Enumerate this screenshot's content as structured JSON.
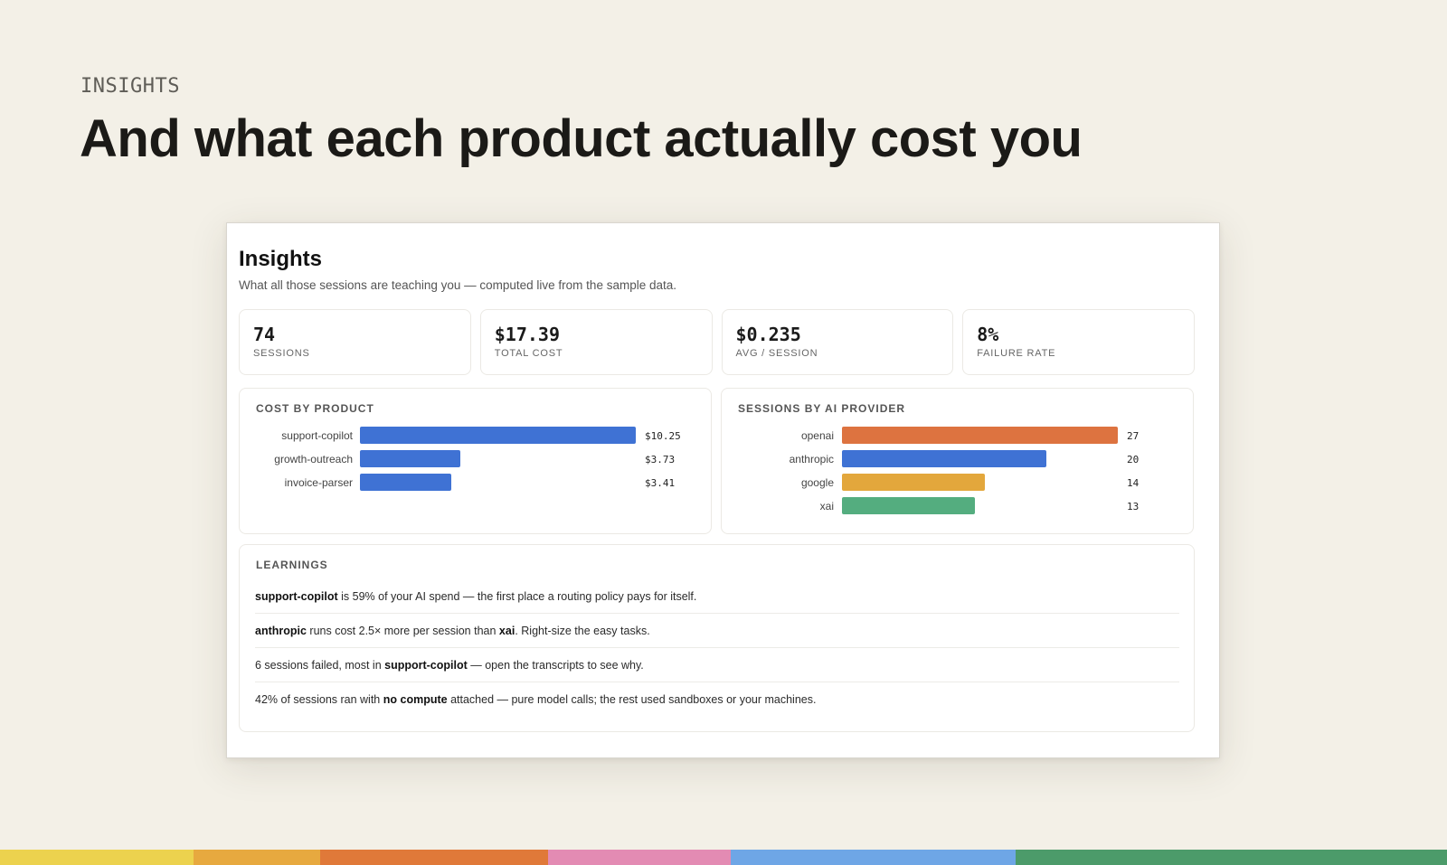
{
  "slide": {
    "eyebrow": "INSIGHTS",
    "headline": "And what each product actually cost you"
  },
  "panel": {
    "title": "Insights",
    "subtitle": "What all those sessions are teaching you — computed live from the sample data."
  },
  "stats": [
    {
      "value": "74",
      "label": "SESSIONS"
    },
    {
      "value": "$17.39",
      "label": "TOTAL COST"
    },
    {
      "value": "$0.235",
      "label": "AVG / SESSION"
    },
    {
      "value": "8%",
      "label": "FAILURE RATE"
    }
  ],
  "chart_data": [
    {
      "type": "bar",
      "title": "COST BY PRODUCT",
      "orientation": "horizontal",
      "categories": [
        "support-copilot",
        "growth-outreach",
        "invoice-parser"
      ],
      "values": [
        10.25,
        3.73,
        3.41
      ],
      "value_labels": [
        "$10.25",
        "$3.73",
        "$3.41"
      ],
      "colors": [
        "#3f72d4",
        "#3f72d4",
        "#3f72d4"
      ]
    },
    {
      "type": "bar",
      "title": "SESSIONS BY AI PROVIDER",
      "orientation": "horizontal",
      "categories": [
        "openai",
        "anthropic",
        "google",
        "xai"
      ],
      "values": [
        27,
        20,
        14,
        13
      ],
      "value_labels": [
        "27",
        "20",
        "14",
        "13"
      ],
      "colors": [
        "#dd7340",
        "#3f72d4",
        "#e3a73c",
        "#54ad7f"
      ]
    }
  ],
  "learnings": {
    "heading": "LEARNINGS",
    "items": [
      {
        "parts": [
          {
            "b": true,
            "t": "support-copilot"
          },
          {
            "b": false,
            "t": " is 59% of your AI spend — the first place a routing policy pays for itself."
          }
        ]
      },
      {
        "parts": [
          {
            "b": true,
            "t": "anthropic"
          },
          {
            "b": false,
            "t": " runs cost 2.5× more per session than "
          },
          {
            "b": true,
            "t": "xai"
          },
          {
            "b": false,
            "t": ". Right-size the easy tasks."
          }
        ]
      },
      {
        "parts": [
          {
            "b": false,
            "t": "6 sessions failed, most in "
          },
          {
            "b": true,
            "t": "support-copilot"
          },
          {
            "b": false,
            "t": " — open the transcripts to see why."
          }
        ]
      },
      {
        "parts": [
          {
            "b": false,
            "t": "42% of sessions ran with "
          },
          {
            "b": true,
            "t": "no compute"
          },
          {
            "b": false,
            "t": " attached — pure model calls; the rest used sandboxes or your machines."
          }
        ]
      }
    ]
  },
  "stripe_colors": [
    "#ecd24e",
    "#e7a93f",
    "#e07939",
    "#e38bb3",
    "#6ea6e6",
    "#4c9b6a"
  ],
  "stripe_fractions": [
    0.134,
    0.087,
    0.158,
    0.126,
    0.197,
    0.298
  ]
}
